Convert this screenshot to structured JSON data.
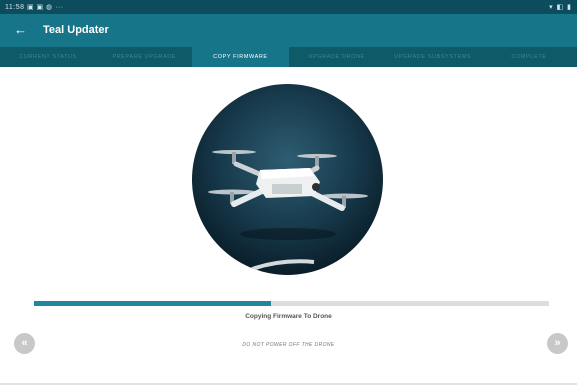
{
  "status_bar": {
    "left": "11:58 ▣ ▣ ◍ ···",
    "right": "▾ ◧ ▮"
  },
  "app_bar": {
    "title": "Teal Updater",
    "back_icon": "arrow-left-icon"
  },
  "tabs": [
    {
      "label": "Current Status",
      "active": false
    },
    {
      "label": "Prepare Upgrade",
      "active": false
    },
    {
      "label": "Copy Firmware",
      "active": true
    },
    {
      "label": "Upgrade Drone",
      "active": false
    },
    {
      "label": "Upgrade Subsystems",
      "active": false
    },
    {
      "label": "Complete",
      "active": false
    }
  ],
  "progress": {
    "fraction": 0.46,
    "status_text": "Copying Firmware To Drone",
    "warning_text": "DO NOT POWER OFF THE DRONE"
  },
  "nav": {
    "prev_label": "«",
    "next_label": "»"
  },
  "colors": {
    "status_bar": "#0d4c5c",
    "app_bar": "#17758a",
    "tab_bar": "#0e5a69",
    "progress_fill": "#1f88a0",
    "progress_track": "#dddddd"
  }
}
